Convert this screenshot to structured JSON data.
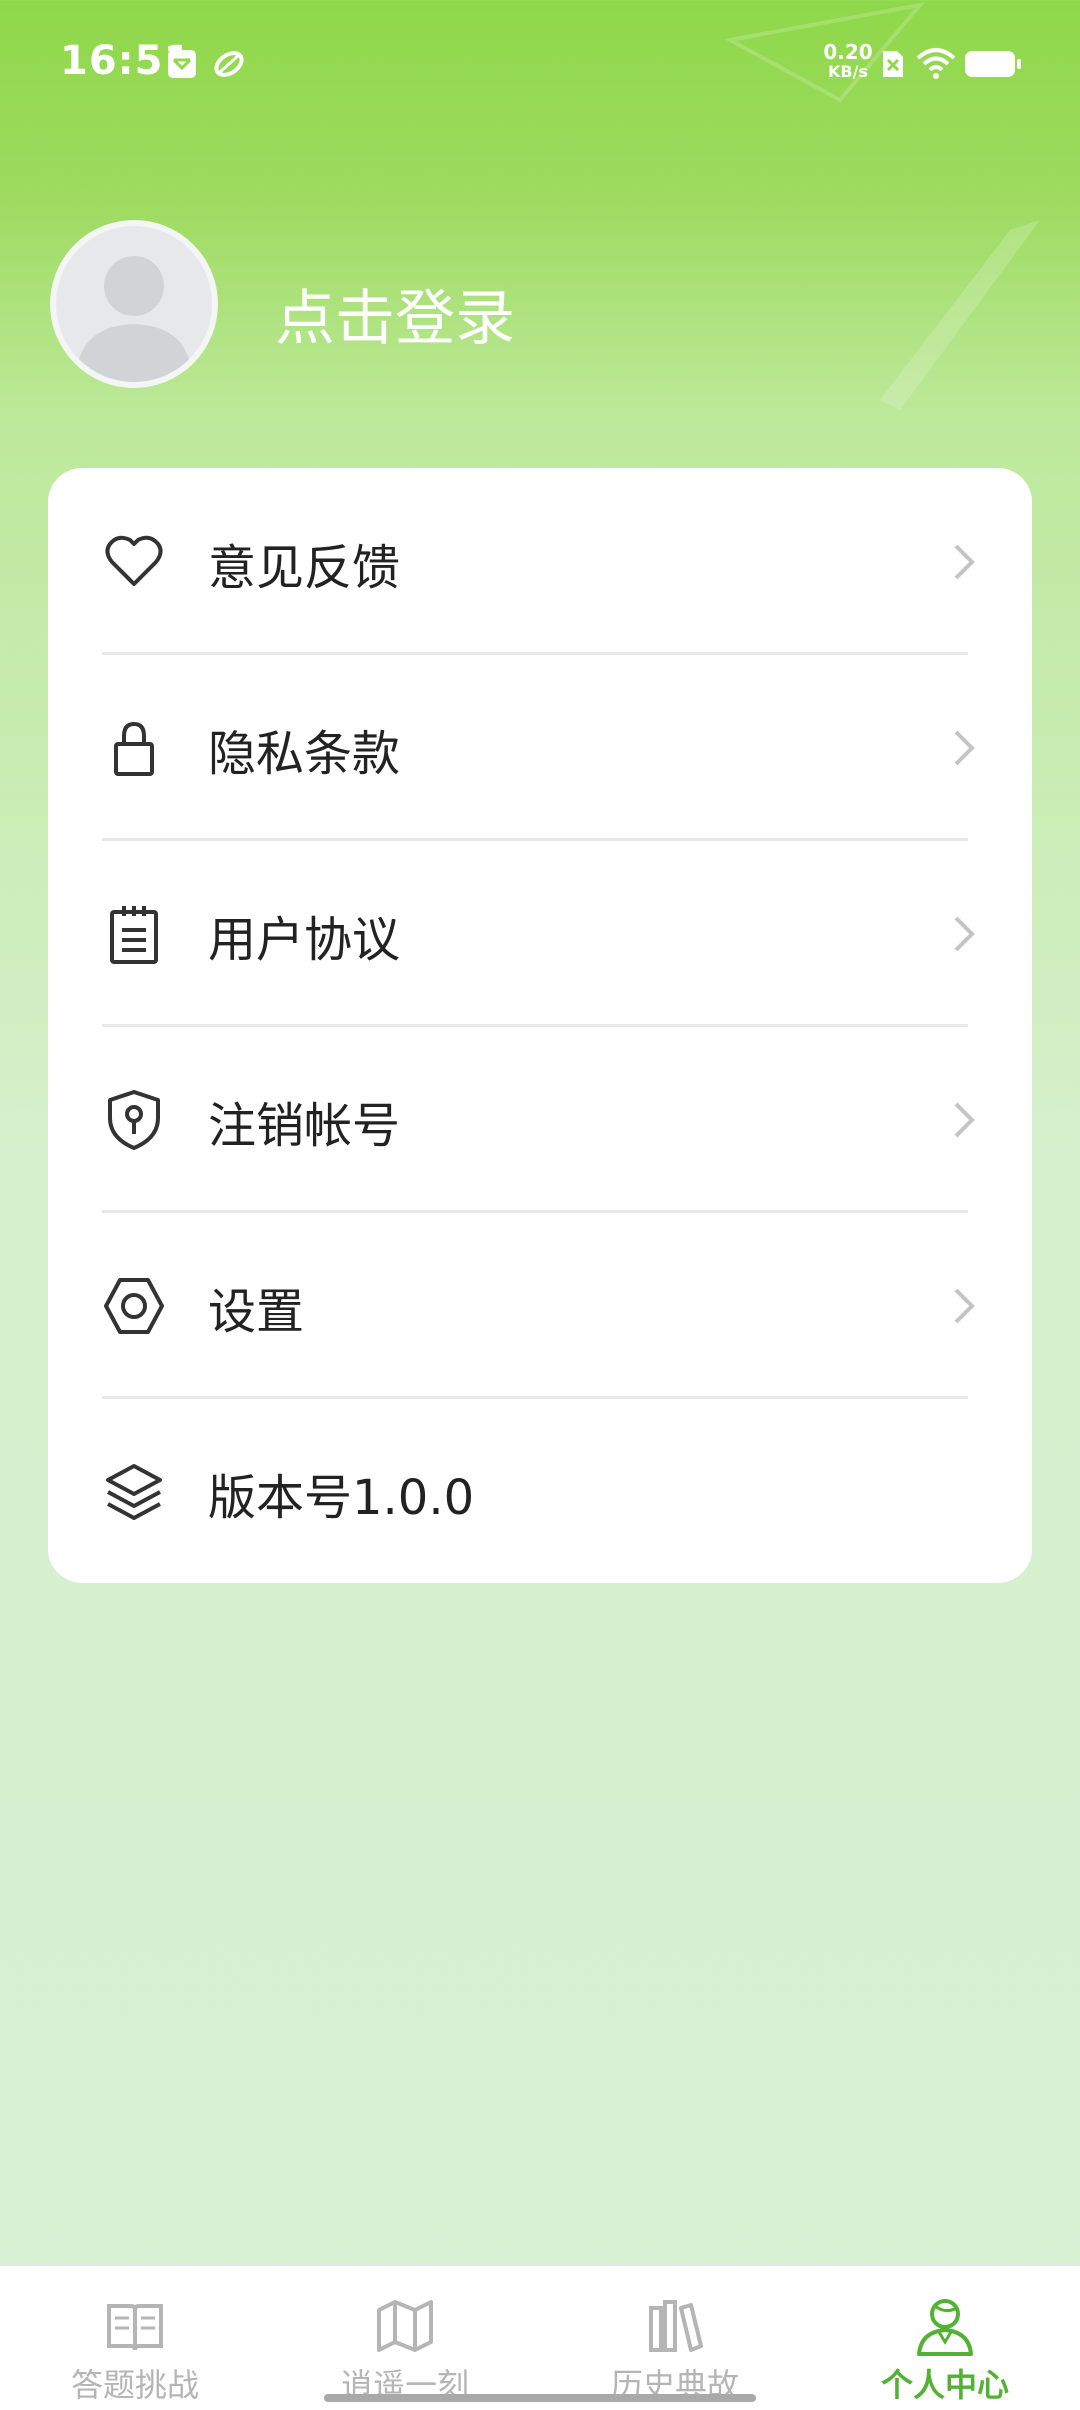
{
  "status_bar": {
    "time": "16:51",
    "net_speed_value": "0.20",
    "net_speed_unit": "KB/s",
    "icons": [
      "notification-box-icon",
      "app-leaf-icon",
      "sim-off-icon",
      "wifi-icon",
      "battery-icon"
    ]
  },
  "profile": {
    "login_text": "点击登录"
  },
  "menu": {
    "items": [
      {
        "label": "意见反馈",
        "icon": "heart-icon",
        "has_arrow": true
      },
      {
        "label": "隐私条款",
        "icon": "lock-icon",
        "has_arrow": true
      },
      {
        "label": "用户协议",
        "icon": "notepad-icon",
        "has_arrow": true
      },
      {
        "label": "注销帐号",
        "icon": "shield-key-icon",
        "has_arrow": true
      },
      {
        "label": "设置",
        "icon": "hexagon-gear-icon",
        "has_arrow": true
      },
      {
        "label": "版本号1.0.0",
        "icon": "layers-icon",
        "has_arrow": false
      }
    ]
  },
  "tabbar": {
    "tabs": [
      {
        "label": "答题挑战",
        "icon": "book-icon",
        "active": false
      },
      {
        "label": "逍遥一刻",
        "icon": "map-icon",
        "active": false
      },
      {
        "label": "历史典故",
        "icon": "books-icon",
        "active": false
      },
      {
        "label": "个人中心",
        "icon": "person-icon",
        "active": true
      }
    ]
  },
  "colors": {
    "accent": "#52b233",
    "header_green": "#8fd84a",
    "background_light": "#d8f1d4",
    "tab_inactive": "#b5b5b5"
  }
}
